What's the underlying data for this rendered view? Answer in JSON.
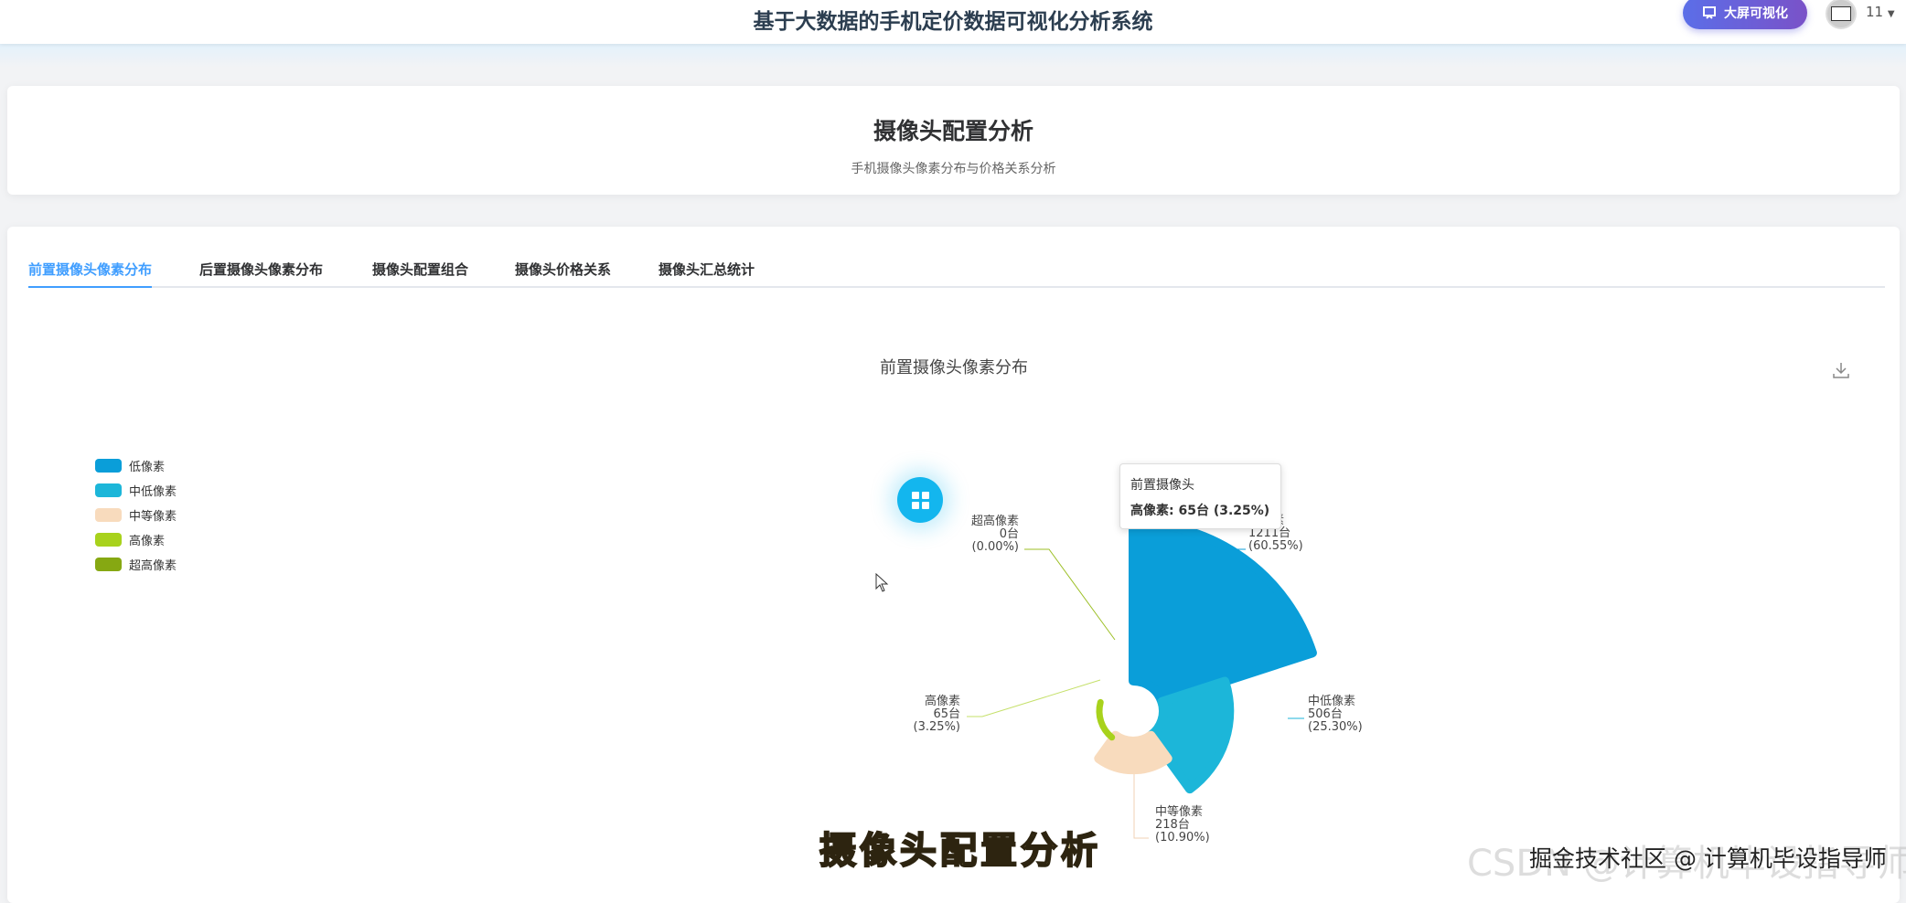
{
  "header": {
    "title": "基于大数据的手机定价数据可视化分析系统",
    "bigscreen_label": "大屏可视化",
    "user": "11"
  },
  "page": {
    "title": "摄像头配置分析",
    "subtitle": "手机摄像头像素分布与价格关系分析"
  },
  "tabs": [
    {
      "label": "前置摄像头像素分布",
      "active": true
    },
    {
      "label": "后置摄像头像素分布"
    },
    {
      "label": "摄像头配置组合"
    },
    {
      "label": "摄像头价格关系"
    },
    {
      "label": "摄像头汇总统计"
    }
  ],
  "chart_data": {
    "type": "pie",
    "rose_type": "area",
    "title": "前置摄像头像素分布",
    "series_name": "前置摄像头",
    "unit": "台",
    "categories": [
      "低像素",
      "中低像素",
      "中等像素",
      "高像素",
      "超高像素"
    ],
    "values": [
      1211,
      506,
      218,
      65,
      0
    ],
    "percents": [
      "60.55%",
      "25.30%",
      "10.90%",
      "3.25%",
      "0.00%"
    ],
    "colors": [
      "#0a9ed9",
      "#1cb6d9",
      "#f8dbbd",
      "#a8d21c",
      "#86a812"
    ],
    "legend_position": "left",
    "labels": [
      {
        "name": "低像素",
        "count": "1211台",
        "pct": "(60.55%)"
      },
      {
        "name": "中低像素",
        "count": "506台",
        "pct": "(25.30%)"
      },
      {
        "name": "中等像素",
        "count": "218台",
        "pct": "(10.90%)"
      },
      {
        "name": "高像素",
        "count": "65台",
        "pct": "(3.25%)"
      },
      {
        "name": "超高像素",
        "count": "0台",
        "pct": "(0.00%)"
      }
    ],
    "tooltip": {
      "title": "前置摄像头",
      "text": "高像素: 65台 (3.25%)"
    }
  },
  "overlay": {
    "caption": "摄像头配置分析",
    "watermark_juejin": "掘金技术社区 @ 计算机毕设指导师",
    "watermark_csdn": "CSDN @计算机毕设指导师"
  }
}
